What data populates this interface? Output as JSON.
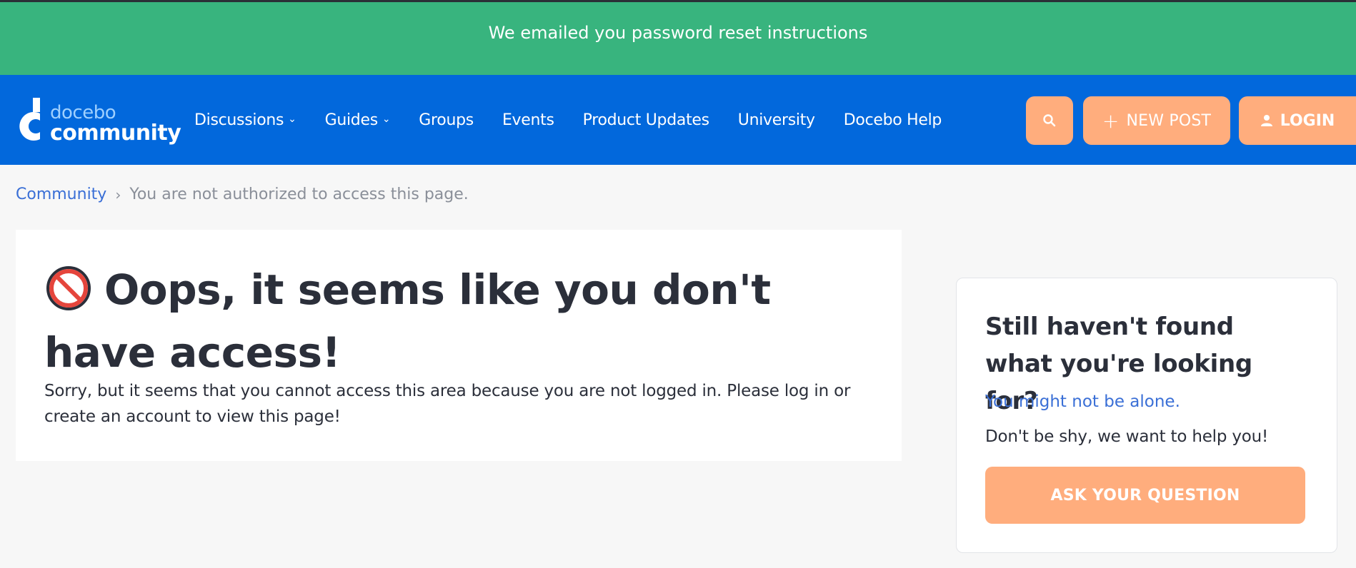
{
  "banner": {
    "message": "We emailed you password reset instructions"
  },
  "logo": {
    "line1": "docebo",
    "line2": "community"
  },
  "nav": {
    "items": [
      {
        "label": "Discussions",
        "has_dropdown": true
      },
      {
        "label": "Guides",
        "has_dropdown": true
      },
      {
        "label": "Groups",
        "has_dropdown": false
      },
      {
        "label": "Events",
        "has_dropdown": false
      },
      {
        "label": "Product Updates",
        "has_dropdown": false
      },
      {
        "label": "University",
        "has_dropdown": false
      },
      {
        "label": "Docebo Help",
        "has_dropdown": false
      }
    ],
    "search_icon": "search-icon",
    "new_post_label": "NEW POST",
    "login_label": "LOGIN"
  },
  "breadcrumb": {
    "root": "Community",
    "separator": "›",
    "current": "You are not authorized to access this page."
  },
  "main": {
    "title": "Oops, it seems like you don't have access!",
    "description": "Sorry, but it seems that you cannot access this area because you are not logged in. Please log in or create an account to view this page!"
  },
  "side": {
    "title": "Still haven't found what you're looking for?",
    "link": "You might not be alone.",
    "text": "Don't be shy, we want to help you!",
    "button_label": "ASK YOUR QUESTION"
  },
  "colors": {
    "banner": "#38b47e",
    "navbar": "#0268dc",
    "accent_button": "#ffad7d",
    "link": "#3a6fd6",
    "text": "#2b2f3a"
  }
}
